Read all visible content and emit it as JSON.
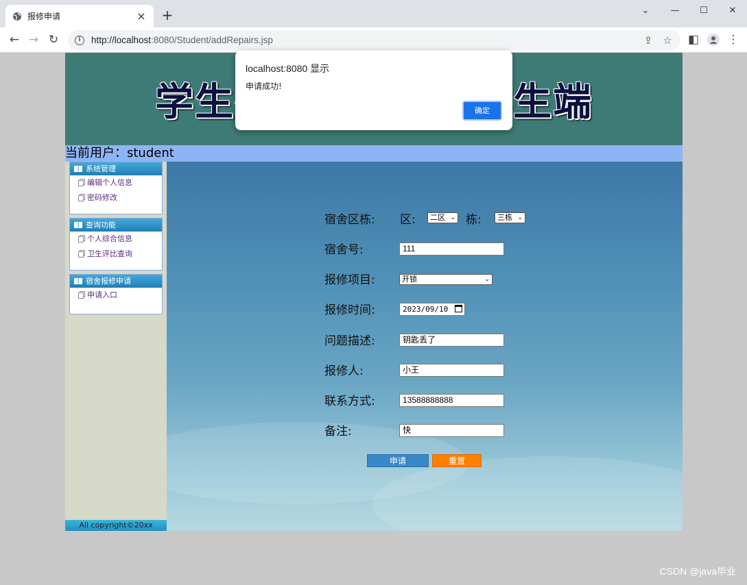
{
  "browser": {
    "tab_title": "报修申请",
    "new_tab": "+",
    "url_host": "http://localhost",
    "url_path": ":8080/Student/addRepairs.jsp"
  },
  "banner": {
    "title": "学生宿舍管理系统学生端"
  },
  "user_bar": {
    "text": "当前用户：student"
  },
  "sidebar": {
    "groups": [
      {
        "title": "系统管理",
        "items": [
          "编辑个人信息",
          "密码修改"
        ]
      },
      {
        "title": "查询功能",
        "items": [
          "个人综合信息",
          "卫生评比查询"
        ]
      },
      {
        "title": "宿舍报修申请",
        "items": [
          "申请入口"
        ]
      }
    ],
    "footer": "All copyright©20xx"
  },
  "form": {
    "area_label": "宿舍区栋:",
    "zone_label": "区:",
    "zone_value": "二区",
    "building_label": "栋:",
    "building_value": "三栋",
    "room_label": "宿舍号:",
    "room_value": "111",
    "item_label": "报修项目:",
    "item_value": "开锁",
    "time_label": "报修时间:",
    "time_value": "2023/09/10",
    "desc_label": "问题描述:",
    "desc_value": "钥匙丢了",
    "reporter_label": "报修人:",
    "reporter_value": "小王",
    "contact_label": "联系方式:",
    "contact_value": "13588888888",
    "note_label": "备注:",
    "note_value": "快",
    "submit_label": "申请",
    "reset_label": "重置"
  },
  "dialog": {
    "title": "localhost:8080 显示",
    "message": "申请成功!",
    "ok_label": "确定"
  },
  "watermark": "CSDN @java毕业",
  "colors": {
    "banner_bg": "#3e7b77",
    "user_bar_bg": "#8fb4f5",
    "submit_bg": "#3a87c8",
    "reset_bg": "#ff7f00",
    "dialog_ok": "#1a73e8"
  }
}
